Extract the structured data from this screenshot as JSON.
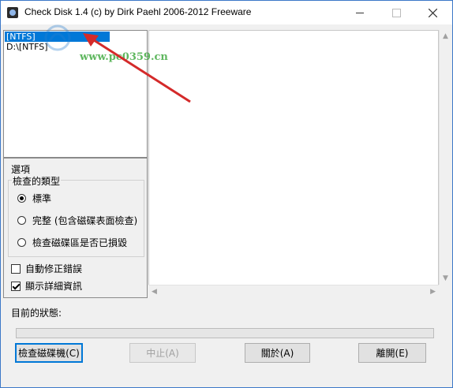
{
  "window": {
    "title": "Check Disk 1.4  (c) by Dirk Paehl  2006-2012 Freeware",
    "controls": {
      "minimize": "minimize-icon",
      "maximize": "maximize-icon",
      "close": "close-icon"
    }
  },
  "drives": {
    "items": [
      "[NTFS]",
      "D:\\[NTFS]"
    ]
  },
  "options": {
    "label": "選項",
    "type_group": {
      "label": "檢查的類型",
      "choices": [
        {
          "label": "標準",
          "checked": true
        },
        {
          "label": "完整 (包含磁碟表面檢查)",
          "checked": false
        },
        {
          "label": "檢查磁碟區是否已損毀",
          "checked": false
        }
      ]
    },
    "auto_fix": {
      "label": "自動修正錯誤",
      "checked": false
    },
    "verbose": {
      "label": "顯示詳細資訊",
      "checked": true
    }
  },
  "status": {
    "label": "目前的狀態:",
    "progress": 0
  },
  "buttons": {
    "check": "檢查磁碟機(C)",
    "stop": "中止(A)",
    "about": "關於(A)",
    "exit": "離開(E)"
  },
  "watermark": {
    "site": "www.pc0359.cn"
  },
  "colors": {
    "selection": "#0078d7",
    "annotation_arrow": "#d42a2a",
    "watermark": "#2aa02a"
  }
}
